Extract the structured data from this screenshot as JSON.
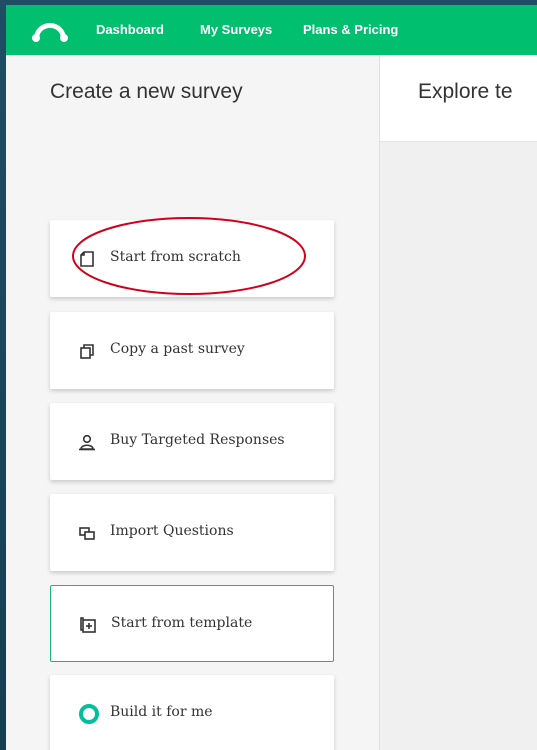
{
  "nav": {
    "items": [
      "Dashboard",
      "My Surveys",
      "Plans & Pricing"
    ]
  },
  "left": {
    "title": "Create a new survey",
    "options": [
      {
        "label": "Start from scratch",
        "icon": "blank-page-icon"
      },
      {
        "label": "Copy a past survey",
        "icon": "copy-icon"
      },
      {
        "label": "Buy Targeted Responses",
        "icon": "audience-icon"
      },
      {
        "label": "Import Questions",
        "icon": "import-icon"
      },
      {
        "label": "Start from template",
        "icon": "template-icon",
        "selected": true
      },
      {
        "label": "Build it for me",
        "icon": "ring-icon"
      }
    ]
  },
  "right": {
    "title": "Explore te"
  },
  "colors": {
    "brand": "#00bf6f",
    "annotation": "#d0021b",
    "selected_border": "#19b878"
  }
}
